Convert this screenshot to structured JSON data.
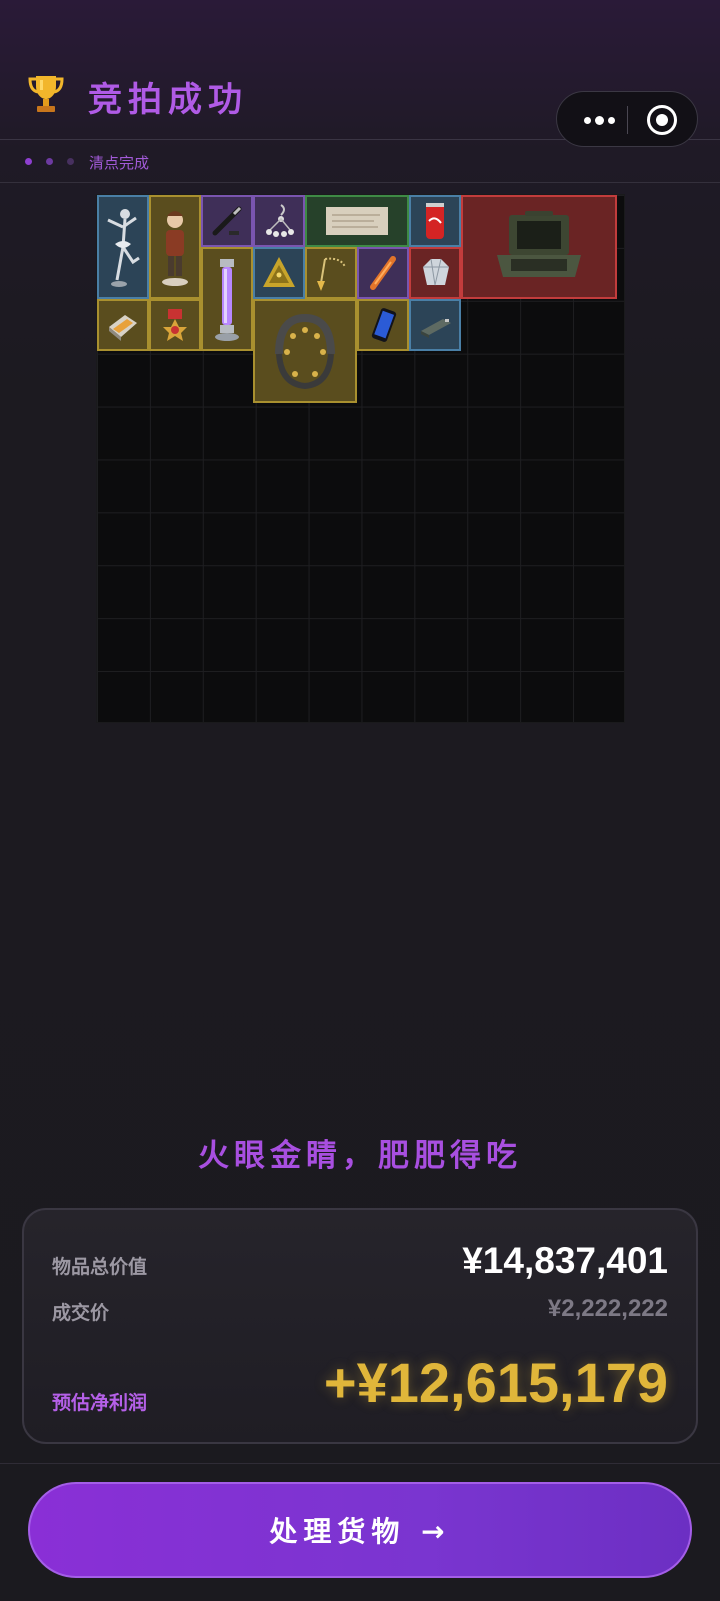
{
  "header": {
    "title": "竞拍成功",
    "step_label": "清点完成"
  },
  "capsule": {
    "more_icon": "more-dots-icon",
    "close_icon": "target-circle-icon"
  },
  "items": [
    {
      "name": "ballerina-figurine",
      "rarity": "blue"
    },
    {
      "name": "boy-figurine",
      "rarity": "gold"
    },
    {
      "name": "pen",
      "rarity": "purple"
    },
    {
      "name": "earring",
      "rarity": "purple"
    },
    {
      "name": "old-document",
      "rarity": "green"
    },
    {
      "name": "cola-can",
      "rarity": "blue"
    },
    {
      "name": "military-laptop-case",
      "rarity": "red"
    },
    {
      "name": "uv-lamp-tube",
      "rarity": "gold"
    },
    {
      "name": "pyramid",
      "rarity": "blue"
    },
    {
      "name": "pendulum-pendant",
      "rarity": "gold"
    },
    {
      "name": "orange-stick",
      "rarity": "purple"
    },
    {
      "name": "diamond",
      "rarity": "red"
    },
    {
      "name": "gold-bars",
      "rarity": "gold"
    },
    {
      "name": "medal",
      "rarity": "gold"
    },
    {
      "name": "headset-device",
      "rarity": "gold"
    },
    {
      "name": "smartphone",
      "rarity": "gold"
    },
    {
      "name": "usb-drive",
      "rarity": "blue"
    }
  ],
  "colors": {
    "blue": "#4a7fa6",
    "gold": "#a9902f",
    "purple": "#7a55b0",
    "green": "#3e8a45",
    "red": "#c23c3c",
    "accent": "#b05be6",
    "profit": "#e0b63a"
  },
  "slogan": "火眼金睛，肥肥得吃",
  "summary": {
    "total_label": "物品总价值",
    "total_value": "¥14,837,401",
    "deal_label": "成交价",
    "deal_value": "¥2,222,222",
    "profit_label": "预估净利润",
    "profit_value": "+¥12,615,179"
  },
  "cta": {
    "label": "处理货物 →"
  }
}
